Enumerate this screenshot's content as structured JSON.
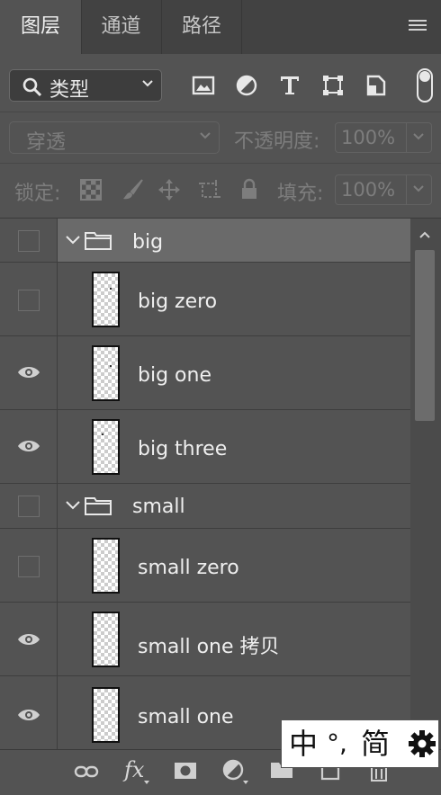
{
  "tabs": [
    {
      "label": "图层",
      "active": true
    },
    {
      "label": "通道",
      "active": false
    },
    {
      "label": "路径",
      "active": false
    }
  ],
  "filter": {
    "select_label": "类型",
    "icons": [
      "image-filter-icon",
      "adjustment-filter-icon",
      "type-filter-icon",
      "shape-filter-icon",
      "smart-object-filter-icon"
    ]
  },
  "blend": {
    "mode_label": "穿透",
    "opacity_label": "不透明度:",
    "opacity_value": "100%"
  },
  "lock": {
    "label": "锁定:",
    "fill_label": "填充:",
    "fill_value": "100%"
  },
  "layers": [
    {
      "type": "group",
      "name": "big",
      "visible": false,
      "selected": true
    },
    {
      "type": "layer",
      "name": "big zero",
      "visible": false
    },
    {
      "type": "layer",
      "name": "big one",
      "visible": true
    },
    {
      "type": "layer",
      "name": "big three",
      "visible": true
    },
    {
      "type": "group",
      "name": "small",
      "visible": false,
      "selected": false
    },
    {
      "type": "layer",
      "name": "small zero",
      "visible": false
    },
    {
      "type": "layer",
      "name": "small one 拷贝",
      "visible": true
    },
    {
      "type": "layer",
      "name": "small one",
      "visible": true
    }
  ],
  "bottom_toolbar": {
    "fx_label": "fx"
  },
  "ime": {
    "mode": "中",
    "punct": "°,",
    "script": "简"
  },
  "colors": {
    "panel_bg": "#535353",
    "tabbar_bg": "#424242",
    "selected_group": "#6a6a6a",
    "text": "#efefef"
  }
}
